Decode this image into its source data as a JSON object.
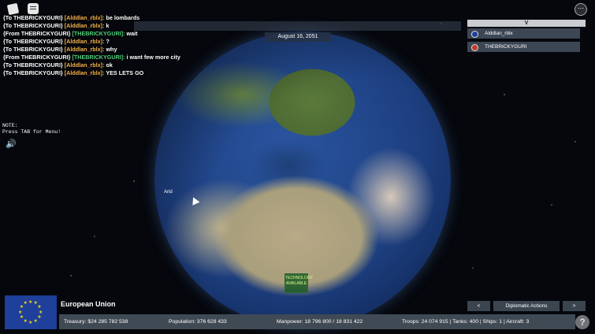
{
  "game": {
    "date": "August 16, 2051",
    "note_label": "NOTE:",
    "note_text": "Press TAB for Menu!",
    "map_label": "Arid",
    "tech_badge": "TECHNOLOGY AVAILABLE",
    "menu_icon": "ellipsis-icon"
  },
  "chat": [
    {
      "prefix": "{To THEBRICKYGURI}",
      "name": "[Alddlan_rblx]:",
      "msg": " be lombards",
      "name_color": "orange"
    },
    {
      "prefix": "{To THEBRICKYGURI}",
      "name": "[Alddlan_rblx]:",
      "msg": " k",
      "name_color": "orange"
    },
    {
      "prefix": "{From THEBRICKYGURI}",
      "name": "[THEBRICKYGURI]:",
      "msg": " wait",
      "name_color": "green"
    },
    {
      "prefix": "{To THEBRICKYGURI}",
      "name": "[Alddlan_rblx]:",
      "msg": " ?",
      "name_color": "orange"
    },
    {
      "prefix": "{To THEBRICKYGURI}",
      "name": "[Alddlan_rblx]:",
      "msg": " why",
      "name_color": "orange"
    },
    {
      "prefix": "{From THEBRICKYGURI}",
      "name": "[THEBRICKYGURI]:",
      "msg": " i want few more city",
      "name_color": "green"
    },
    {
      "prefix": "{To THEBRICKYGURI}",
      "name": "[Alddlan_rblx]:",
      "msg": " ok",
      "name_color": "orange"
    },
    {
      "prefix": "{To THEBRICKYGURI}",
      "name": "[Alddlan_rblx]:",
      "msg": " YES LETS GO",
      "name_color": "orange"
    }
  ],
  "players": {
    "dropdown_label": "V",
    "items": [
      {
        "name": "Alddlan_rblx",
        "color": "#1e3f9a"
      },
      {
        "name": "THEBRICKYGURI",
        "color": "#c0392b"
      }
    ]
  },
  "country": {
    "name": "European Union",
    "flag_color": "#1e3f9a",
    "star_color": "#f5d21a"
  },
  "nav": {
    "prev": "<",
    "diplomatic": "Diplomatic Actions",
    "next": ">"
  },
  "stats": {
    "treasury": "Treasury:  $24 285 782 538",
    "population": "Population: 376 628 433",
    "manpower": "Manpower: 18 796 800  /  18 831 422",
    "military": "Troops: 24 074 915  |  Tanks: 400  |  Ships: 1  |  Aircraft: 3"
  },
  "help_label": "?"
}
